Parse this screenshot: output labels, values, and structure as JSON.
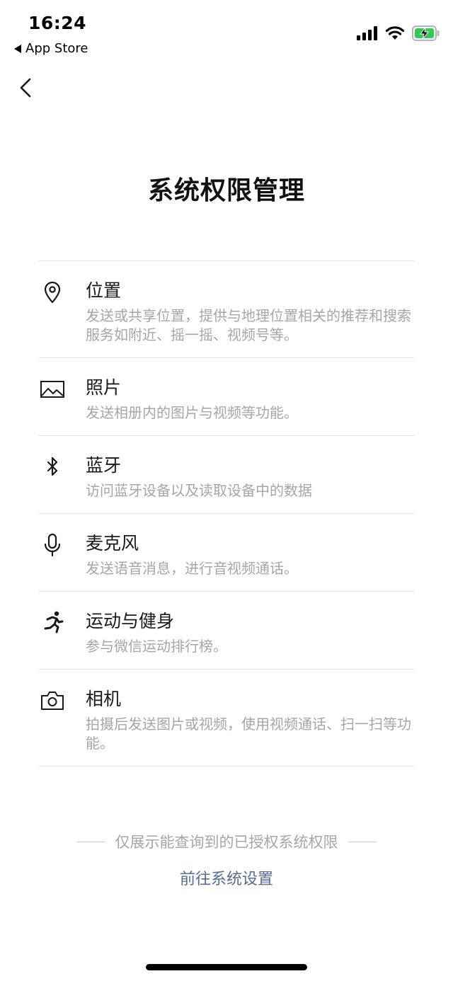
{
  "status_bar": {
    "time": "16:24",
    "back_app_label": "App Store",
    "icons": [
      "signal-icon",
      "wifi-icon",
      "battery-charging-icon"
    ],
    "battery_color": "#34c759"
  },
  "nav": {
    "back_icon": "chevron-left-icon"
  },
  "page_title": "系统权限管理",
  "permissions": [
    {
      "icon": "location-pin-icon",
      "name": "位置",
      "desc": "发送或共享位置，提供与地理位置相关的推荐和搜索服务如附近、摇一摇、视频号等。"
    },
    {
      "icon": "photo-icon",
      "name": "照片",
      "desc": "发送相册内的图片与视频等功能。"
    },
    {
      "icon": "bluetooth-icon",
      "name": "蓝牙",
      "desc": "访问蓝牙设备以及读取设备中的数据"
    },
    {
      "icon": "microphone-icon",
      "name": "麦克风",
      "desc": "发送语音消息，进行音视频通话。"
    },
    {
      "icon": "running-icon",
      "name": "运动与健身",
      "desc": "参与微信运动排行榜。"
    },
    {
      "icon": "camera-icon",
      "name": "相机",
      "desc": "拍摄后发送图片或视频，使用视频通话、扫一扫等功能。"
    }
  ],
  "footer": {
    "note": "仅展示能查询到的已授权系统权限",
    "link_label": "前往系统设置",
    "link_color": "#576b95"
  }
}
